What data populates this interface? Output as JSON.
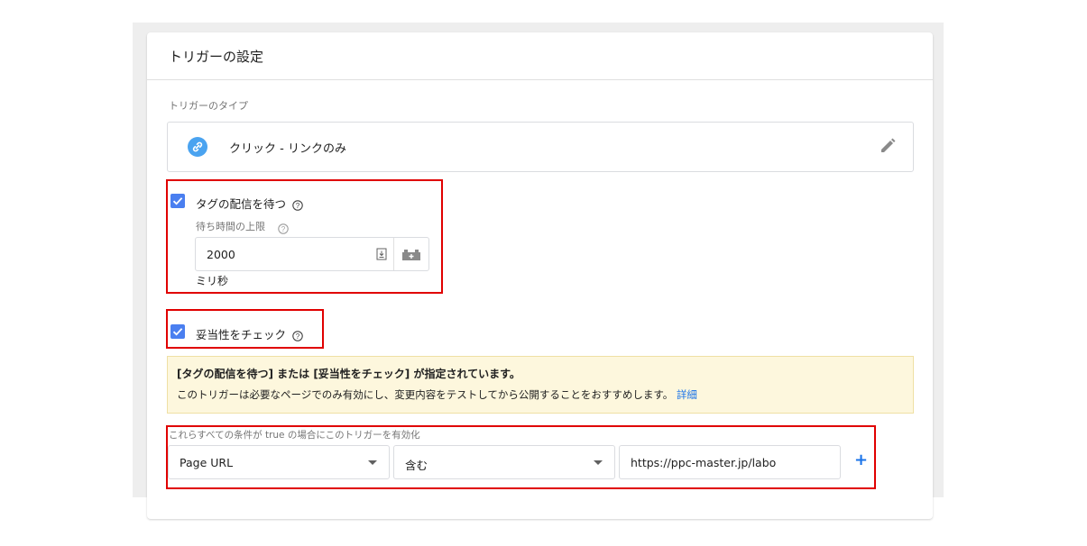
{
  "trigger_settings": {
    "title": "トリガーの設定",
    "type_section_label": "トリガーのタイプ",
    "trigger_type": "クリック - リンクのみ",
    "wait_for_tags": {
      "label": "タグの配信を待つ",
      "checked": true,
      "max_wait_label": "待ち時間の上限",
      "value": "2000",
      "unit": "ミリ秒"
    },
    "check_validation": {
      "label": "妥当性をチェック",
      "checked": true
    },
    "warning": {
      "title": "[タグの配信を待つ] または [妥当性をチェック] が指定されています。",
      "body": "このトリガーは必要なページでのみ有効にし、変更内容をテストしてから公開することをおすすめします。",
      "link": "詳細"
    },
    "condition": {
      "label": "これらすべての条件が true の場合にこのトリガーを有効化",
      "variable": "Page URL",
      "operator": "含む",
      "value": "https://ppc-master.jp/labo",
      "add_symbol": "+"
    }
  },
  "colors": {
    "accent": "#4a7ff0",
    "link": "#1a73e8",
    "highlight": "#e00000",
    "warning_bg": "#fdf7dd"
  },
  "icons": [
    "link-icon",
    "pencil-icon",
    "help-icon",
    "stepper-icon",
    "variable-picker-icon",
    "chevron-down-icon",
    "plus-icon",
    "check-icon"
  ]
}
